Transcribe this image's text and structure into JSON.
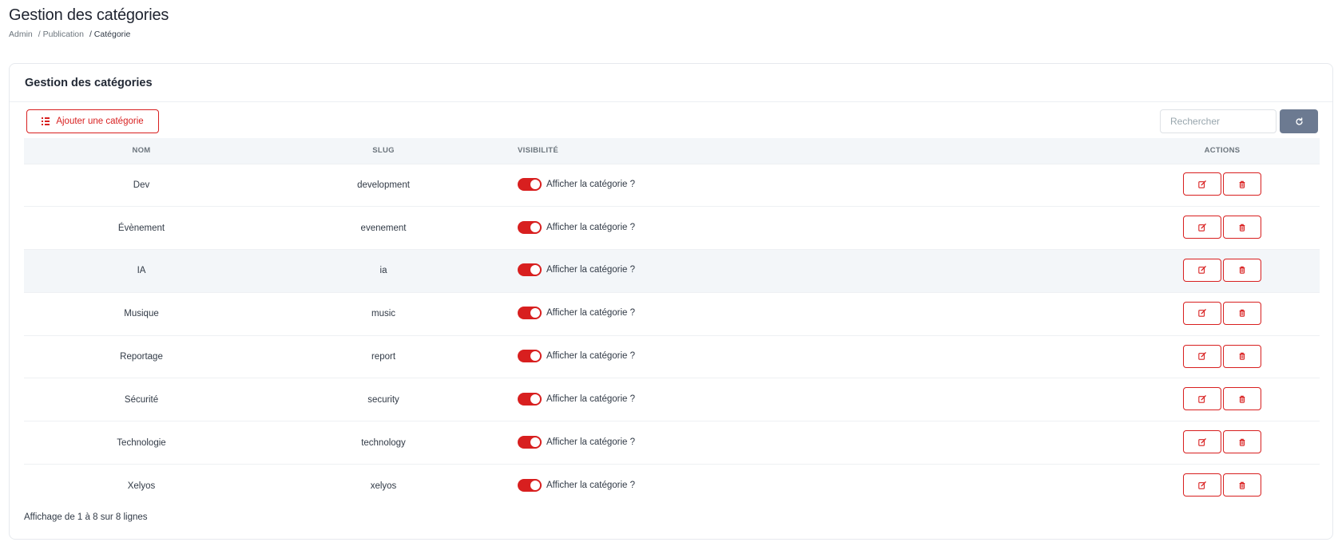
{
  "page": {
    "title": "Gestion des catégories",
    "breadcrumb": [
      "Admin",
      "/ Publication",
      "/ Catégorie"
    ]
  },
  "card": {
    "title": "Gestion des catégories",
    "add_label": "Ajouter une catégorie",
    "search_placeholder": "Rechercher",
    "refresh_icon": "refresh-icon"
  },
  "table": {
    "headers": [
      "NOM",
      "SLUG",
      "VISIBILITÉ",
      "ACTIONS"
    ],
    "rows": [
      {
        "name": "Dev",
        "slug": "development",
        "visible": true,
        "visibility_label": "Afficher la catégorie ?"
      },
      {
        "name": "Évènement",
        "slug": "evenement",
        "visible": true,
        "visibility_label": "Afficher la catégorie ?"
      },
      {
        "name": "IA",
        "slug": "ia",
        "visible": true,
        "visibility_label": "Afficher la catégorie ?"
      },
      {
        "name": "Musique",
        "slug": "music",
        "visible": true,
        "visibility_label": "Afficher la catégorie ?"
      },
      {
        "name": "Reportage",
        "slug": "report",
        "visible": true,
        "visibility_label": "Afficher la catégorie ?"
      },
      {
        "name": "Sécurité",
        "slug": "security",
        "visible": true,
        "visibility_label": "Afficher la catégorie ?"
      },
      {
        "name": "Technologie",
        "slug": "technology",
        "visible": true,
        "visibility_label": "Afficher la catégorie ?"
      },
      {
        "name": "Xelyos",
        "slug": "xelyos",
        "visible": true,
        "visibility_label": "Afficher la catégorie ?"
      }
    ],
    "hover_row": 2
  },
  "footer": {
    "info": "Affichage de 1 à 8 sur 8 lignes"
  },
  "colors": {
    "accent": "#d81f1f",
    "refresh_bg": "#6c7a91",
    "header_bg": "#f3f6f9"
  }
}
